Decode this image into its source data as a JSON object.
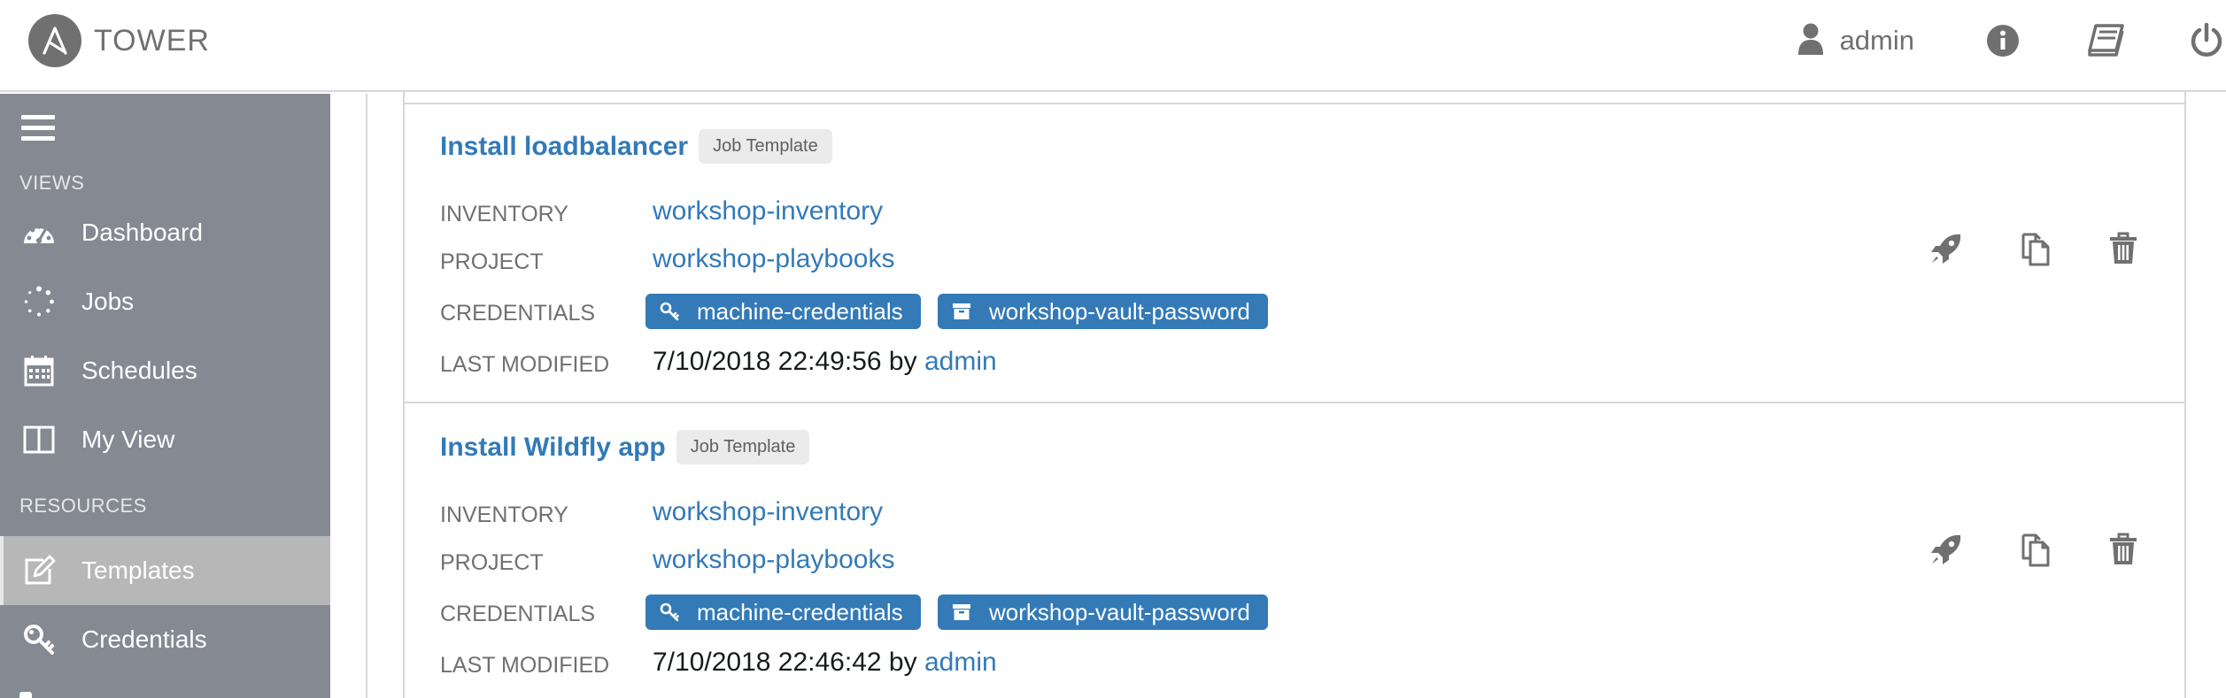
{
  "header": {
    "brand_name": "TOWER",
    "user_name": "admin",
    "icons": [
      "user-icon",
      "info-icon",
      "book-icon",
      "power-icon"
    ]
  },
  "sidebar": {
    "views_label": "VIEWS",
    "resources_label": "RESOURCES",
    "items": [
      {
        "label": "Dashboard",
        "icon": "dashboard-icon"
      },
      {
        "label": "Jobs",
        "icon": "jobs-spinner-icon"
      },
      {
        "label": "Schedules",
        "icon": "calendar-icon"
      },
      {
        "label": "My View",
        "icon": "columns-icon"
      },
      {
        "label": "Templates",
        "icon": "edit-icon",
        "active": true
      },
      {
        "label": "Credentials",
        "icon": "key-icon"
      }
    ]
  },
  "labels": {
    "inventory": "INVENTORY",
    "project": "PROJECT",
    "credentials": "CREDENTIALS",
    "last_modified": "LAST MODIFIED",
    "by": "by"
  },
  "templates": [
    {
      "name": "Install loadbalancer",
      "tag": "Job Template",
      "inventory": "workshop-inventory",
      "project": "workshop-playbooks",
      "credentials": [
        "machine-credentials",
        "workshop-vault-password"
      ],
      "modified_date": "7/10/2018 22:49:56",
      "modified_by": "admin"
    },
    {
      "name": "Install Wildfly app",
      "tag": "Job Template",
      "inventory": "workshop-inventory",
      "project": "workshop-playbooks",
      "credentials": [
        "machine-credentials",
        "workshop-vault-password"
      ],
      "modified_date": "7/10/2018 22:46:42",
      "modified_by": "admin"
    }
  ],
  "colors": {
    "accent": "#337ab7",
    "sidebar": "#848992",
    "sidebar_active": "#b7b7b7",
    "muted": "#707070"
  }
}
